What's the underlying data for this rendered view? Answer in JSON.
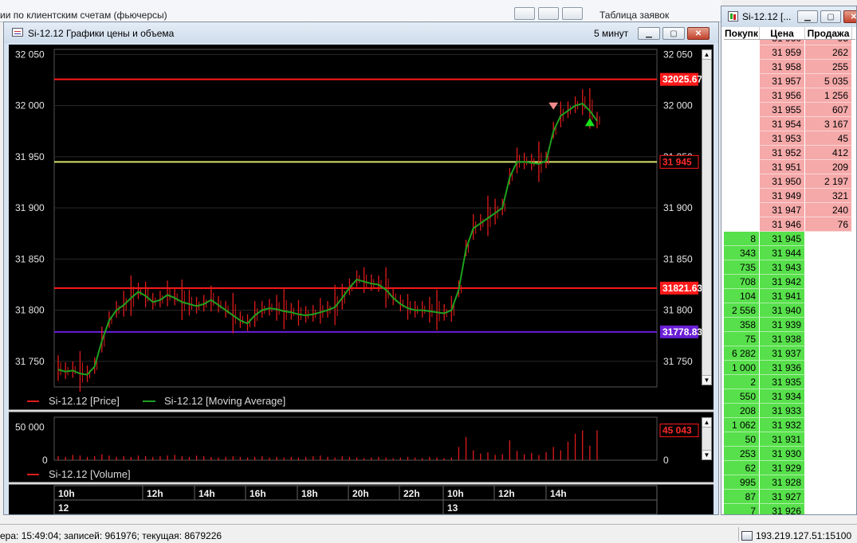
{
  "background": {
    "left_window_title": "ии по клиентским счетам (фьючерсы)",
    "right_window_title": "Таблица заявок"
  },
  "chart_window": {
    "title": "Si-12.12 Графики цены и объема",
    "timeframe": "5 минут",
    "legend_price": "Si-12.12 [Price]",
    "legend_ma": "Si-12.12 [Moving Average]",
    "legend_volume": "Si-12.12 [Volume]",
    "price_ticks": [
      "32 050",
      "32 000",
      "31 950",
      "31 900",
      "31 850",
      "31 800",
      "31 750"
    ],
    "volume_ticks": [
      "50 000",
      "0"
    ],
    "time_labels": [
      "10h",
      "12h",
      "14h",
      "16h",
      "18h",
      "20h",
      "22h",
      "10h",
      "12h",
      "14h"
    ],
    "day_labels": [
      "12",
      "13"
    ],
    "levels": [
      {
        "value": 32025.67,
        "label": "32025.67",
        "color": "#ff1a1a"
      },
      {
        "value": 31945,
        "label": "31 945",
        "color": "#d7e36a"
      },
      {
        "value": 31821.63,
        "label": "31821.63",
        "color": "#ff1a1a"
      },
      {
        "value": 31778.83,
        "label": "31778.83",
        "color": "#6a1fd6"
      }
    ],
    "current_volume_label": "45 043",
    "colors": {
      "price": "#e01b1b",
      "ma": "#1fa01f",
      "grid": "#2a2a2a",
      "axis_text": "#e6e6e6"
    }
  },
  "chart_data": [
    {
      "type": "line",
      "series": [
        {
          "name": "Si-12.12 [Moving Average]",
          "values": [
            31742,
            31740,
            31741,
            31738,
            31737,
            31745,
            31770,
            31790,
            31800,
            31805,
            31812,
            31818,
            31814,
            31808,
            31810,
            31815,
            31812,
            31808,
            31806,
            31804,
            31806,
            31810,
            31805,
            31800,
            31795,
            31790,
            31787,
            31795,
            31800,
            31802,
            31801,
            31799,
            31798,
            31796,
            31795,
            31796,
            31798,
            31800,
            31803,
            31812,
            31822,
            31830,
            31828,
            31826,
            31825,
            31820,
            31812,
            31806,
            31802,
            31800,
            31800,
            31799,
            31798,
            31797,
            31800,
            31820,
            31860,
            31880,
            31885,
            31890,
            31895,
            31900,
            31930,
            31945,
            31945,
            31944,
            31943,
            31946,
            31975,
            31990,
            31995,
            32000,
            32002,
            31995,
            31985
          ]
        }
      ],
      "ylim": [
        31725,
        32055
      ],
      "x_ticks": [
        "10h",
        "12h",
        "14h",
        "16h",
        "18h",
        "20h",
        "22h",
        "10h",
        "12h",
        "14h"
      ]
    },
    {
      "type": "bar",
      "series": [
        {
          "name": "Si-12.12 [Volume]",
          "values": [
            6000,
            5000,
            8000,
            7000,
            5000,
            6000,
            9000,
            7000,
            5000,
            6000,
            5000,
            7000,
            6000,
            5000,
            6000,
            7000,
            8000,
            6000,
            5000,
            7000,
            6000,
            5000,
            4000,
            5000,
            6000,
            5000,
            4000,
            5000,
            6000,
            4000,
            5000,
            4000,
            5000,
            4000,
            5000,
            6000,
            7000,
            5000,
            4000,
            6000,
            5000,
            4000,
            3000,
            4000,
            5000,
            4000,
            3000,
            4000,
            5000,
            4000,
            3000,
            5000,
            4000,
            3000,
            4000,
            20000,
            35000,
            15000,
            10000,
            12000,
            8000,
            9000,
            30000,
            14000,
            9000,
            11000,
            8000,
            12000,
            20000,
            15000,
            28000,
            40000,
            45000,
            22000,
            45043
          ]
        }
      ],
      "ylim": [
        0,
        65000
      ]
    }
  ],
  "order_book": {
    "title": "Si-12.12 [...",
    "headers": [
      "Покупк",
      "Цена",
      "Продажа"
    ],
    "asks": [
      {
        "price": "31 960",
        "qty": "95"
      },
      {
        "price": "31 959",
        "qty": "262"
      },
      {
        "price": "31 958",
        "qty": "255"
      },
      {
        "price": "31 957",
        "qty": "5 035"
      },
      {
        "price": "31 956",
        "qty": "1 256"
      },
      {
        "price": "31 955",
        "qty": "607"
      },
      {
        "price": "31 954",
        "qty": "3 167"
      },
      {
        "price": "31 953",
        "qty": "45"
      },
      {
        "price": "31 952",
        "qty": "412"
      },
      {
        "price": "31 951",
        "qty": "209"
      },
      {
        "price": "31 950",
        "qty": "2 197"
      },
      {
        "price": "31 949",
        "qty": "321"
      },
      {
        "price": "31 947",
        "qty": "240"
      },
      {
        "price": "31 946",
        "qty": "76"
      }
    ],
    "bids": [
      {
        "price": "31 945",
        "qty": "8"
      },
      {
        "price": "31 944",
        "qty": "343"
      },
      {
        "price": "31 943",
        "qty": "735"
      },
      {
        "price": "31 942",
        "qty": "708"
      },
      {
        "price": "31 941",
        "qty": "104"
      },
      {
        "price": "31 940",
        "qty": "2 556"
      },
      {
        "price": "31 939",
        "qty": "358"
      },
      {
        "price": "31 938",
        "qty": "75"
      },
      {
        "price": "31 937",
        "qty": "6 282"
      },
      {
        "price": "31 936",
        "qty": "1 000"
      },
      {
        "price": "31 935",
        "qty": "2"
      },
      {
        "price": "31 934",
        "qty": "550"
      },
      {
        "price": "31 933",
        "qty": "208"
      },
      {
        "price": "31 932",
        "qty": "1 062"
      },
      {
        "price": "31 931",
        "qty": "50"
      },
      {
        "price": "31 930",
        "qty": "253"
      },
      {
        "price": "31 929",
        "qty": "62"
      },
      {
        "price": "31 928",
        "qty": "995"
      },
      {
        "price": "31 927",
        "qty": "87"
      },
      {
        "price": "31 926",
        "qty": "7"
      }
    ],
    "colors": {
      "ask": "#f5a9a9",
      "bid": "#57e04b"
    }
  },
  "statusbar": {
    "left_text": "ера: 15:49:04; записей: 961976; текущая: 8679226",
    "right_text": "193.219.127.51:15100"
  }
}
